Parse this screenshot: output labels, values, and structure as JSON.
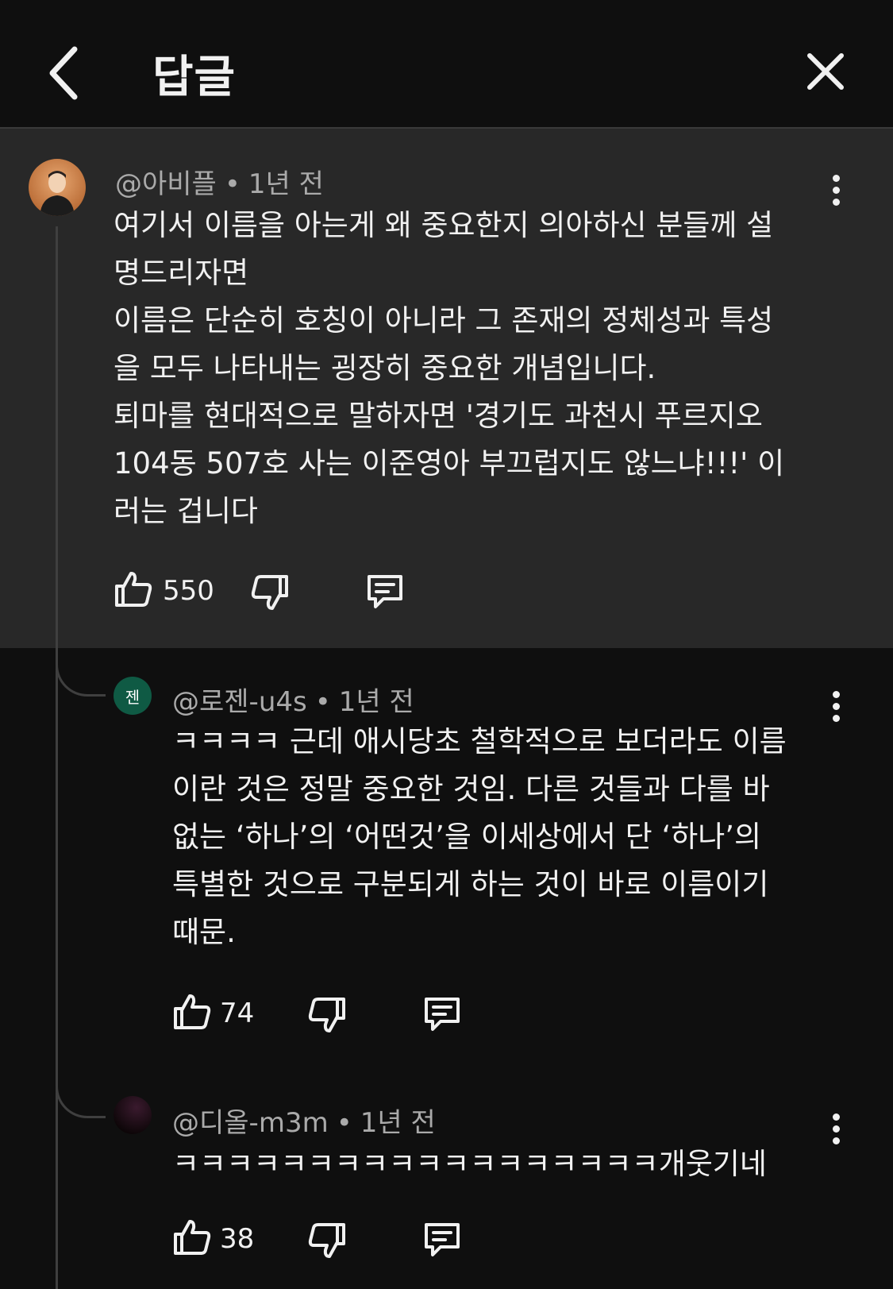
{
  "header": {
    "title": "답글"
  },
  "comments": [
    {
      "author": "@아비플",
      "time": "1년 전",
      "lines": [
        "여기서 이름을 아는게 왜 중요한지 의아하신 분들께 설",
        "명드리자면",
        "이름은 단순히 호칭이 아니라 그 존재의 정체성과 특성",
        "을 모두 나타내는 굉장히 중요한 개념입니다.",
        "퇴마를 현대적으로 말하자면 '경기도 과천시 푸르지오",
        "104동 507호 사는 이준영아 부끄럽지도 않느냐!!!' 이",
        "러는 겁니다"
      ],
      "likes": "550"
    },
    {
      "author": "@로젠-u4s",
      "avatar_text": "젠",
      "time": "1년 전",
      "lines": [
        "ㅋㅋㅋㅋ 근데 애시당초 철학적으로 보더라도 이름",
        "이란 것은 정말 중요한 것임. 다른 것들과 다를 바",
        "없는 ‘하나’의 ‘어떤것’을 이세상에서 단 ‘하나’의",
        "특별한 것으로 구분되게 하는 것이 바로 이름이기",
        "때문."
      ],
      "likes": "74"
    },
    {
      "author": "@디올-m3m",
      "time": "1년 전",
      "lines": [
        "ㅋㅋㅋㅋㅋㅋㅋㅋㅋㅋㅋㅋㅋㅋㅋㅋㅋㅋ개웃기네"
      ],
      "likes": "38"
    }
  ],
  "icons": {
    "back": "chevron-left-icon",
    "close": "close-icon",
    "more": "more-vert-icon",
    "like": "thumbs-up-icon",
    "dislike": "thumbs-down-icon",
    "reply": "reply-icon"
  },
  "colors": {
    "background": "#0f0f0f",
    "highlight": "#282828",
    "secondary_text": "#aaaaaa",
    "green_avatar": "#0f5a44"
  }
}
